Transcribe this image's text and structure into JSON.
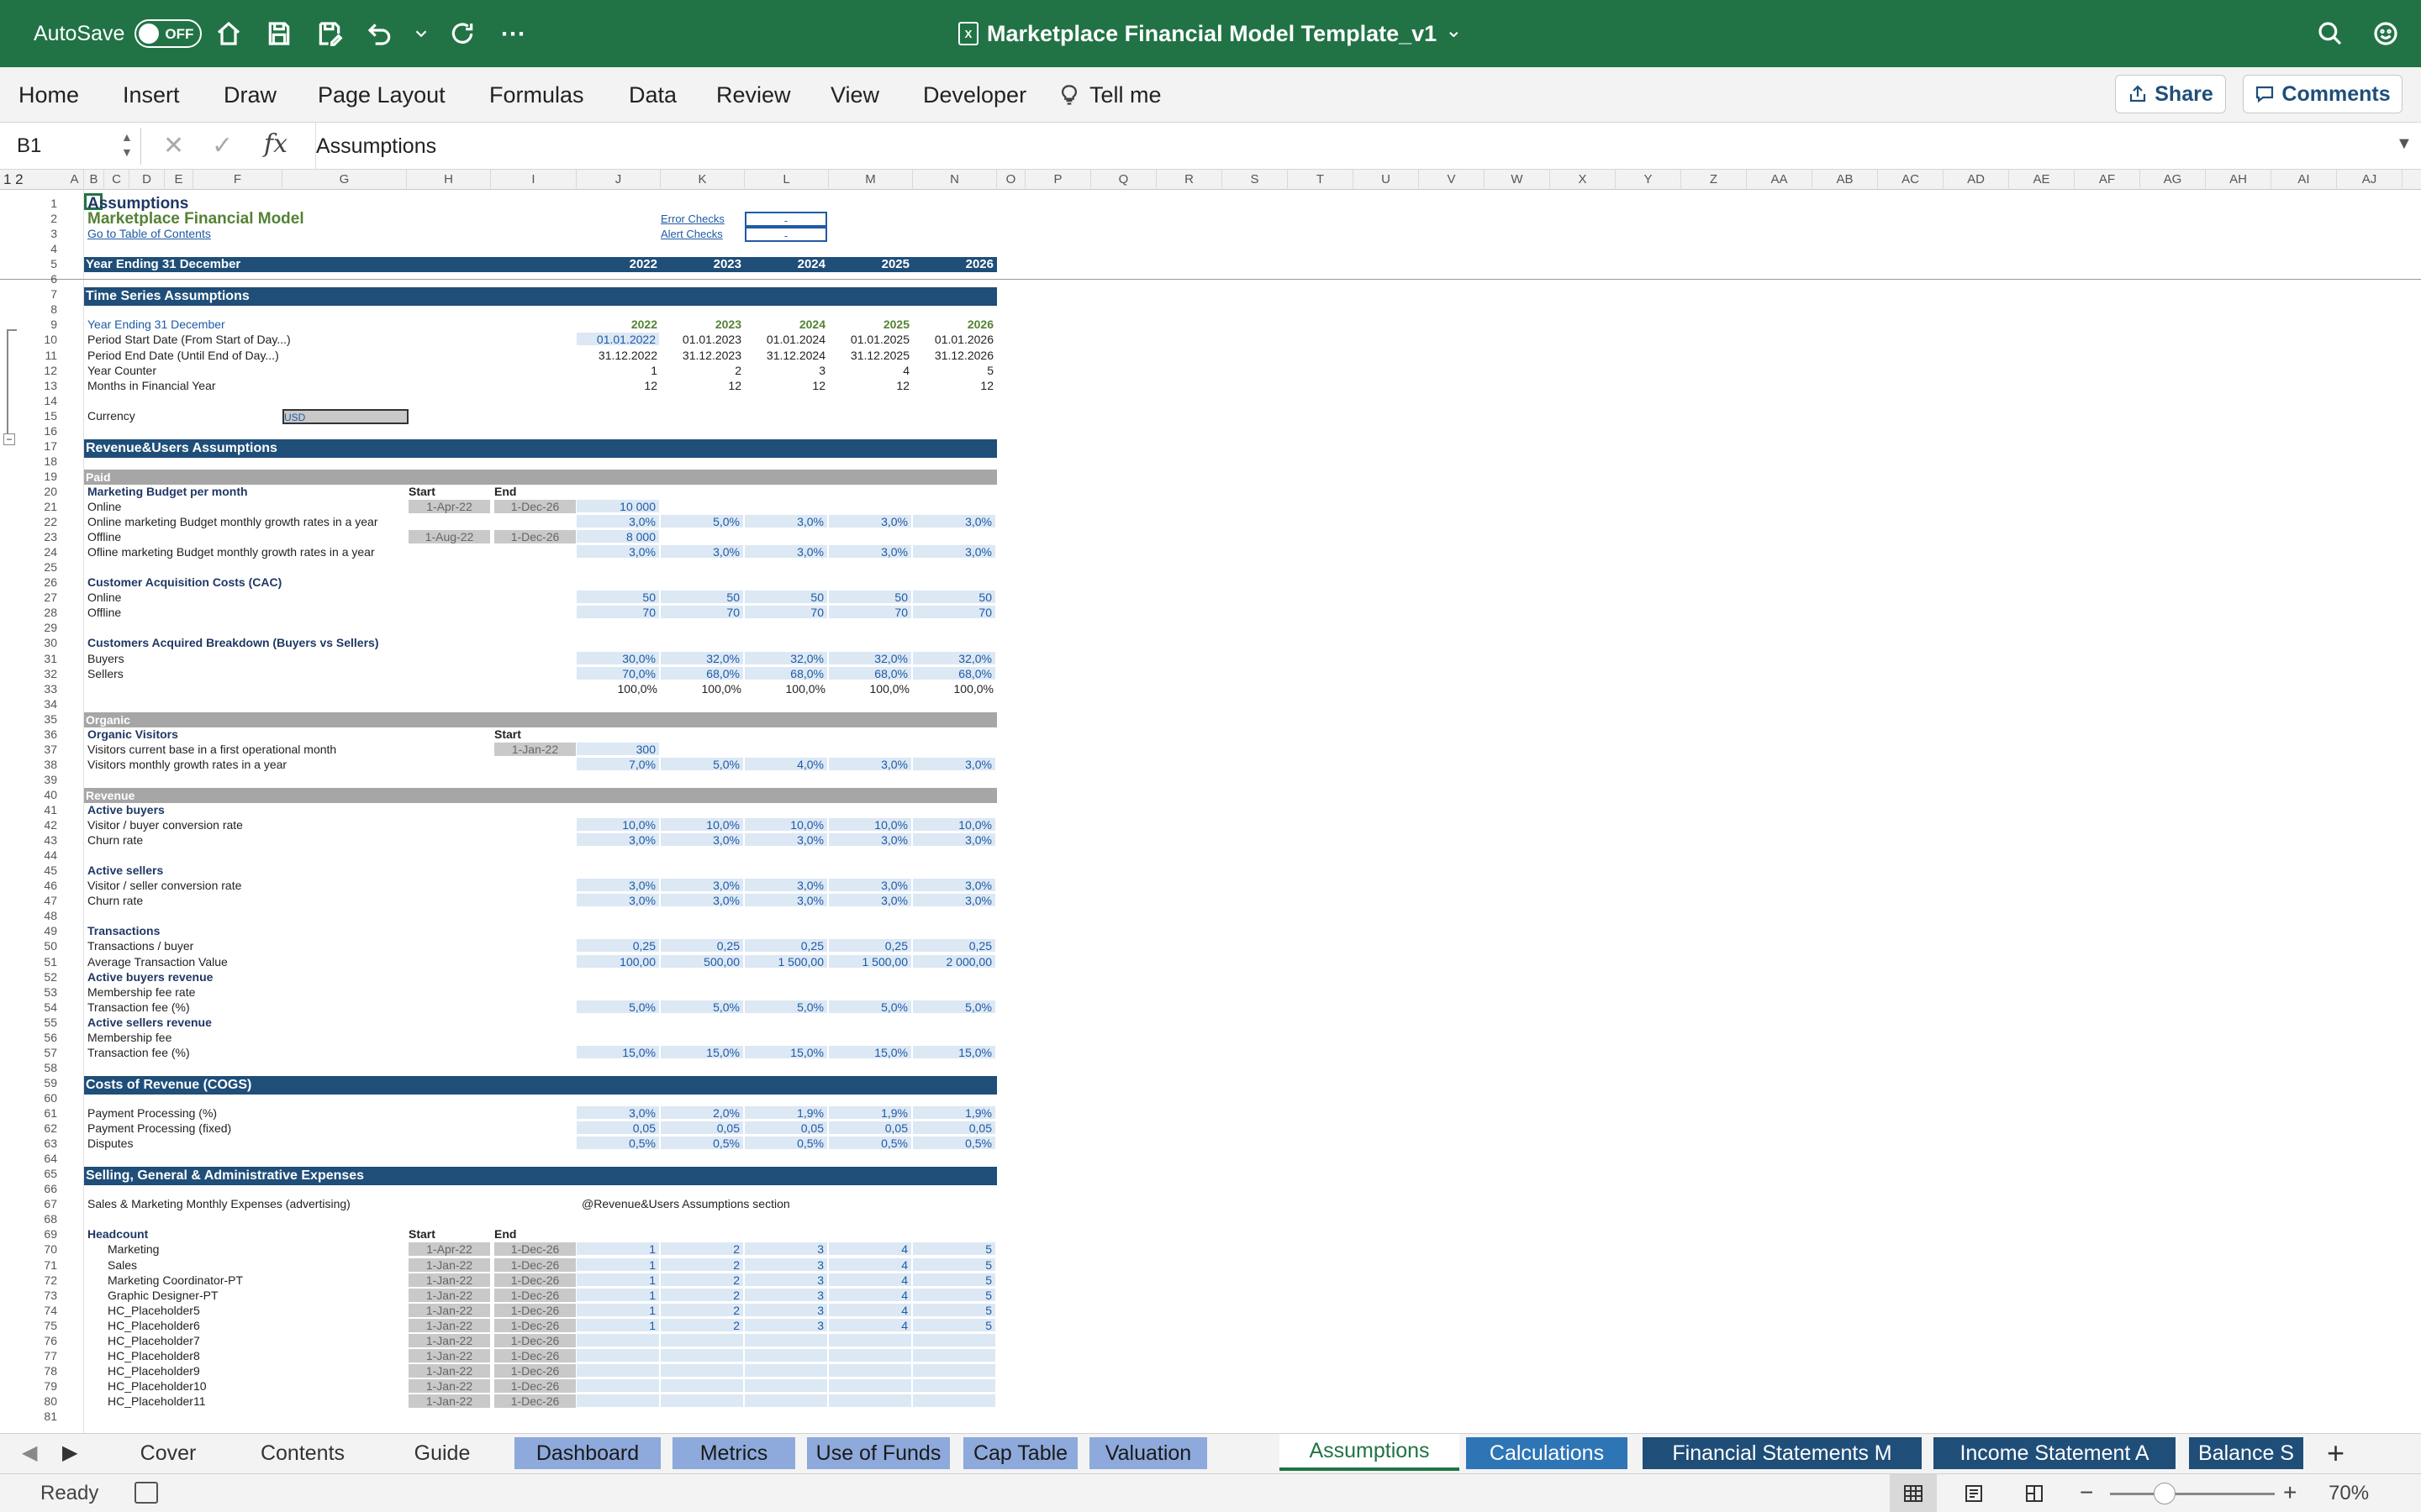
{
  "titlebar": {
    "autosave": "AutoSave",
    "toggle": "OFF",
    "title": "Marketplace Financial Model Template_v1",
    "chevron": "⌄"
  },
  "ribbon": {
    "tabs": [
      "Home",
      "Insert",
      "Draw",
      "Page Layout",
      "Formulas",
      "Data",
      "Review",
      "View",
      "Developer"
    ],
    "tell_me": "Tell me",
    "share": "Share",
    "comments": "Comments"
  },
  "formula": {
    "name_box": "B1",
    "fx": "fx",
    "content": "Assumptions"
  },
  "columns": [
    "A",
    "B",
    "C",
    "D",
    "E",
    "F",
    "G",
    "H",
    "I",
    "J",
    "K",
    "L",
    "M",
    "N",
    "O",
    "P",
    "Q",
    "R",
    "S",
    "T",
    "U",
    "V",
    "W",
    "X",
    "Y",
    "Z",
    "AA",
    "AB",
    "AC",
    "AD",
    "AE",
    "AF",
    "AG",
    "AH",
    "AI",
    "AJ"
  ],
  "outline": "1 2",
  "sheet": {
    "title": "Assumptions",
    "model": "Marketplace Financial Model",
    "toc": "Go to Table of Contents",
    "err": "Error Checks",
    "alert": "Alert Checks",
    "dash": "-",
    "year_ending": "Year Ending 31 December",
    "years": [
      "2022",
      "2023",
      "2024",
      "2025",
      "2026"
    ],
    "sec_time": "Time Series Assumptions",
    "ts_labels": [
      "Year Ending 31 December",
      "Period Start Date (From Start of Day...)",
      "Period End Date (Until End of Day...)",
      "Year Counter",
      "Months in Financial Year"
    ],
    "start_dates": [
      "01.01.2022",
      "01.01.2023",
      "01.01.2024",
      "01.01.2025",
      "01.01.2026"
    ],
    "end_dates": [
      "31.12.2022",
      "31.12.2023",
      "31.12.2024",
      "31.12.2025",
      "31.12.2026"
    ],
    "counters": [
      "1",
      "2",
      "3",
      "4",
      "5"
    ],
    "months": [
      "12",
      "12",
      "12",
      "12",
      "12"
    ],
    "currency_label": "Currency",
    "currency": "USD",
    "sec_rev": "Revenue&Users  Assumptions",
    "paid": "Paid",
    "mb": "Marketing Budget per month",
    "start": "Start",
    "end": "End",
    "online": "Online",
    "online_growth": "Online marketing Budget  monthly growth rates in a year",
    "offline": "Offline",
    "offline_growth": "Ofline  marketing Budget  monthly growth rates in a year",
    "online_start": "1-Apr-22",
    "online_end": "1-Dec-26",
    "online_val": "10 000",
    "offline_start": "1-Aug-22",
    "offline_end": "1-Dec-26",
    "offline_val": "8 000",
    "online_g": [
      "3,0%",
      "5,0%",
      "3,0%",
      "3,0%",
      "3,0%"
    ],
    "offline_g": [
      "3,0%",
      "3,0%",
      "3,0%",
      "3,0%",
      "3,0%"
    ],
    "cac": "Customer Acquisition Costs (CAC)",
    "cac_on": [
      "50",
      "50",
      "50",
      "50",
      "50"
    ],
    "cac_off": [
      "70",
      "70",
      "70",
      "70",
      "70"
    ],
    "cab": "Customers Acquired Breakdown (Buyers vs Sellers)",
    "buyers": "Buyers",
    "sellers": "Sellers",
    "buyers_v": [
      "30,0%",
      "32,0%",
      "32,0%",
      "32,0%",
      "32,0%"
    ],
    "sellers_v": [
      "70,0%",
      "68,0%",
      "68,0%",
      "68,0%",
      "68,0%"
    ],
    "tot_v": [
      "100,0%",
      "100,0%",
      "100,0%",
      "100,0%",
      "100,0%"
    ],
    "organic": "Organic",
    "org_vis": "Organic Visitors",
    "vis_base": "Visitors current base in a first operational month",
    "vis_growth": "Visitors monthly growth rates in a year",
    "org_start": "1-Jan-22",
    "org_base": "300",
    "vis_g": [
      "7,0%",
      "5,0%",
      "4,0%",
      "3,0%",
      "3,0%"
    ],
    "revenue": "Revenue",
    "active_buyers": "Active buyers",
    "vb_conv": "Visitor / buyer conversion rate",
    "churn": "Churn rate",
    "vb_v": [
      "10,0%",
      "10,0%",
      "10,0%",
      "10,0%",
      "10,0%"
    ],
    "churn_v": [
      "3,0%",
      "3,0%",
      "3,0%",
      "3,0%",
      "3,0%"
    ],
    "active_sellers": "Active sellers",
    "vs_conv": "Visitor / seller conversion rate",
    "vs_v": [
      "3,0%",
      "3,0%",
      "3,0%",
      "3,0%",
      "3,0%"
    ],
    "churn2_v": [
      "3,0%",
      "3,0%",
      "3,0%",
      "3,0%",
      "3,0%"
    ],
    "transactions": "Transactions",
    "tpb": "Transactions / buyer",
    "atv": "Average Transaction Value",
    "tpb_v": [
      "0,25",
      "0,25",
      "0,25",
      "0,25",
      "0,25"
    ],
    "atv_v": [
      "100,00",
      "500,00",
      "1 500,00",
      "1 500,00",
      "2 000,00"
    ],
    "abr": "Active buyers revenue",
    "mfr": "Membership fee rate",
    "tfee": "Transaction fee  (%)",
    "tf_b": [
      "5,0%",
      "5,0%",
      "5,0%",
      "5,0%",
      "5,0%"
    ],
    "asr": "Active sellers revenue",
    "mf": "Membership fee",
    "tf_s": [
      "15,0%",
      "15,0%",
      "15,0%",
      "15,0%",
      "15,0%"
    ],
    "sec_cogs": "Costs of Revenue (COGS)",
    "pp": "Payment Processing (%)",
    "ppf": "Payment Processing (fixed)",
    "disputes": "Disputes",
    "pp_v": [
      "3,0%",
      "2,0%",
      "1,9%",
      "1,9%",
      "1,9%"
    ],
    "ppf_v": [
      "0,05",
      "0,05",
      "0,05",
      "0,05",
      "0,05"
    ],
    "disp_v": [
      "0,5%",
      "0,5%",
      "0,5%",
      "0,5%",
      "0,5%"
    ],
    "sec_sga": "Selling, General & Administrative Expenses",
    "smme": "Sales & Marketing Monthly  Expenses (advertising)",
    "smme_ref": "@Revenue&Users Assumptions section",
    "headcount": "Headcount",
    "hc": [
      {
        "n": "Marketing",
        "s": "1-Apr-22",
        "e": "1-Dec-26",
        "v": [
          "1",
          "2",
          "3",
          "4",
          "5"
        ]
      },
      {
        "n": "Sales",
        "s": "1-Jan-22",
        "e": "1-Dec-26",
        "v": [
          "1",
          "2",
          "3",
          "4",
          "5"
        ]
      },
      {
        "n": "Marketing Coordinator-PT",
        "s": "1-Jan-22",
        "e": "1-Dec-26",
        "v": [
          "1",
          "2",
          "3",
          "4",
          "5"
        ]
      },
      {
        "n": "Graphic Designer-PT",
        "s": "1-Jan-22",
        "e": "1-Dec-26",
        "v": [
          "1",
          "2",
          "3",
          "4",
          "5"
        ]
      },
      {
        "n": "HC_Placeholder5",
        "s": "1-Jan-22",
        "e": "1-Dec-26",
        "v": [
          "1",
          "2",
          "3",
          "4",
          "5"
        ]
      },
      {
        "n": "HC_Placeholder6",
        "s": "1-Jan-22",
        "e": "1-Dec-26",
        "v": [
          "1",
          "2",
          "3",
          "4",
          "5"
        ]
      },
      {
        "n": "HC_Placeholder7",
        "s": "1-Jan-22",
        "e": "1-Dec-26",
        "v": [
          "",
          "",
          "",
          "",
          ""
        ]
      },
      {
        "n": "HC_Placeholder8",
        "s": "1-Jan-22",
        "e": "1-Dec-26",
        "v": [
          "",
          "",
          "",
          "",
          ""
        ]
      },
      {
        "n": "HC_Placeholder9",
        "s": "1-Jan-22",
        "e": "1-Dec-26",
        "v": [
          "",
          "",
          "",
          "",
          ""
        ]
      },
      {
        "n": "HC_Placeholder10",
        "s": "1-Jan-22",
        "e": "1-Dec-26",
        "v": [
          "",
          "",
          "",
          "",
          ""
        ]
      },
      {
        "n": "HC_Placeholder11",
        "s": "1-Jan-22",
        "e": "1-Dec-26",
        "v": [
          "",
          "",
          "",
          "",
          ""
        ]
      }
    ]
  },
  "sheets": [
    {
      "name": "Cover",
      "style": "plain"
    },
    {
      "name": "Contents",
      "style": "plain"
    },
    {
      "name": "Guide",
      "style": "plain"
    },
    {
      "name": "Dashboard",
      "style": "lav"
    },
    {
      "name": "Metrics",
      "style": "lav"
    },
    {
      "name": "Use of Funds",
      "style": "lav"
    },
    {
      "name": "Cap Table",
      "style": "lav"
    },
    {
      "name": "Valuation",
      "style": "lav"
    },
    {
      "name": "Assumptions",
      "style": "active"
    },
    {
      "name": "Calculations",
      "style": "blue"
    },
    {
      "name": "Financial Statements M",
      "style": "navy"
    },
    {
      "name": "Income Statement A",
      "style": "navy"
    },
    {
      "name": "Balance S",
      "style": "navy"
    }
  ],
  "add_sheet": "+",
  "status": {
    "ready": "Ready",
    "minus": "−",
    "plus": "+",
    "zoom": "70%"
  },
  "colors": {
    "excel_green": "#217346",
    "navy": "#1f4e79",
    "input_fill": "#dce8f4",
    "gray_bar": "#a6a6a6"
  }
}
